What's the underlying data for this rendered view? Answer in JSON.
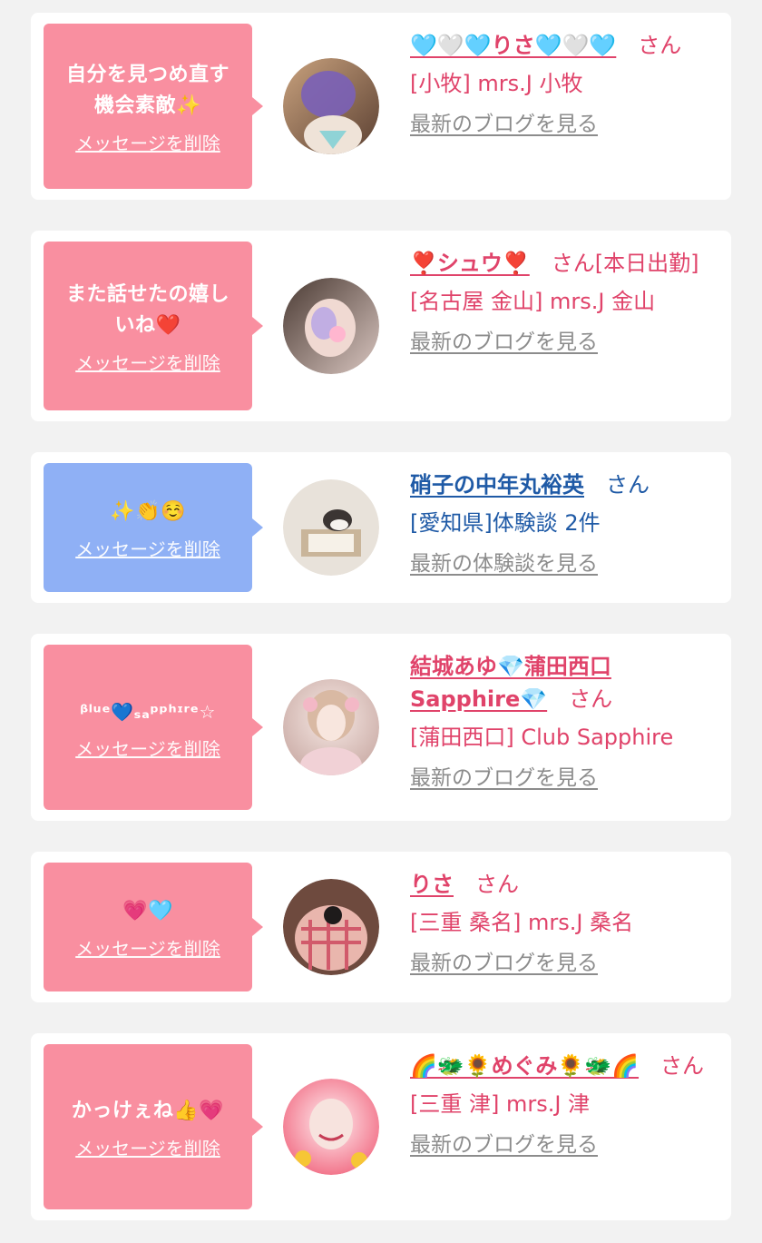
{
  "common": {
    "delete_label": "メッセージを削除",
    "san": "さん"
  },
  "cards": [
    {
      "message": "自分を見つめ直す\n機会素敵✨",
      "name": "🩵🤍🩵りさ🩵🤍🩵",
      "status": "",
      "shop": "[小牧] mrs.J 小牧",
      "link": "最新のブログを見る",
      "bubble_color": "#f98fa0"
    },
    {
      "message": "また話せたの嬉し\nいね❤️",
      "name": "❣️シュウ❣️",
      "status": "[本日出勤]",
      "shop": "[名古屋 金山] mrs.J 金山",
      "link": "最新のブログを見る",
      "bubble_color": "#f98fa0"
    },
    {
      "message": "✨👏☺️",
      "name": "硝子の中年丸裕英",
      "status": "",
      "shop": "[愛知県]体験談 2件",
      "link": "最新の体験談を見る",
      "bubble_color": "#8fb0f5"
    },
    {
      "message": "ᵝˡᵘᵉ💙ₛₐᵖᵖʰᶦʳᵉ☆",
      "name": "結城あゆ💎蒲田西口Sapphire💎",
      "status": "",
      "shop": "[蒲田西口] Club Sapphire",
      "link": "最新のブログを見る",
      "bubble_color": "#f98fa0"
    },
    {
      "message": "💗🩵",
      "name": "りさ",
      "status": "",
      "shop": "[三重 桑名] mrs.J 桑名",
      "link": "最新のブログを見る",
      "bubble_color": "#f98fa0"
    },
    {
      "message": "かっけぇね👍💗",
      "name": "🌈🐲🌻めぐみ🌻🐲🌈",
      "status": "",
      "shop": "[三重 津] mrs.J 津",
      "link": "最新のブログを見る",
      "bubble_color": "#f98fa0"
    }
  ]
}
